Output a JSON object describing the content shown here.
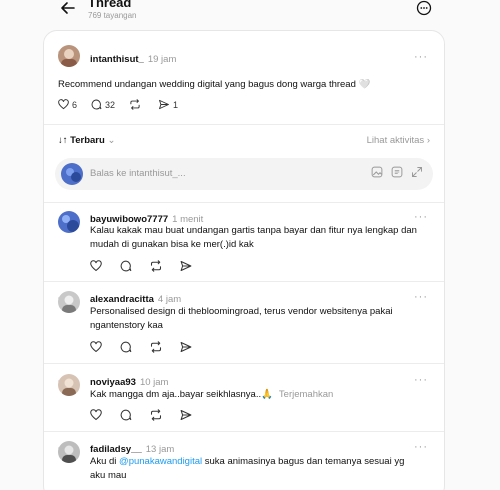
{
  "header": {
    "title": "Thread",
    "views": "769 tayangan"
  },
  "main_post": {
    "username": "intanthisut_",
    "time": "19 jam",
    "text": "Recommend undangan wedding digital yang bagus dong warga thread 🤍",
    "likes": "6",
    "comments": "32",
    "shares": "1"
  },
  "sort": {
    "label": "Terbaru",
    "activity_link": "Lihat aktivitas"
  },
  "reply_box": {
    "placeholder": "Balas ke intanthisut_..."
  },
  "replies": [
    {
      "username": "bayuwibowo7777",
      "time": "1 menit",
      "text_line1": "Kalau kakak mau buat undangan gartis tanpa bayar dan fitur nya lengkap dan",
      "text_line2": "mudah di gunakan bisa ke mer(.)id kak",
      "avatar_color": "#5b7bd5"
    },
    {
      "username": "alexandracitta",
      "time": "4 jam",
      "text_line1": "Personalised design di thebloomingroad, terus vendor websitenya pakai",
      "text_line2": "ngantenstory kaa",
      "avatar_color": "#9a9a9a"
    },
    {
      "username": "noviyaa93",
      "time": "10 jam",
      "text_line1": "Kak mangga dm aja..bayar seikhlasnya..🙏",
      "translate": "Terjemahkan",
      "avatar_color": "#8a6a55"
    },
    {
      "username": "fadiladsy__",
      "time": "13 jam",
      "text_pre": "Aku di ",
      "mention": "@punakawandigital",
      "text_post": " suka animasinya bagus dan temanya sesuai yg",
      "text_line2": "aku mau",
      "avatar_color": "#6f6f6f"
    }
  ],
  "colors": {
    "accent_link": "#1d9bf0",
    "muted": "#999999",
    "card_bg": "#ffffff",
    "page_bg": "#fafafa"
  }
}
